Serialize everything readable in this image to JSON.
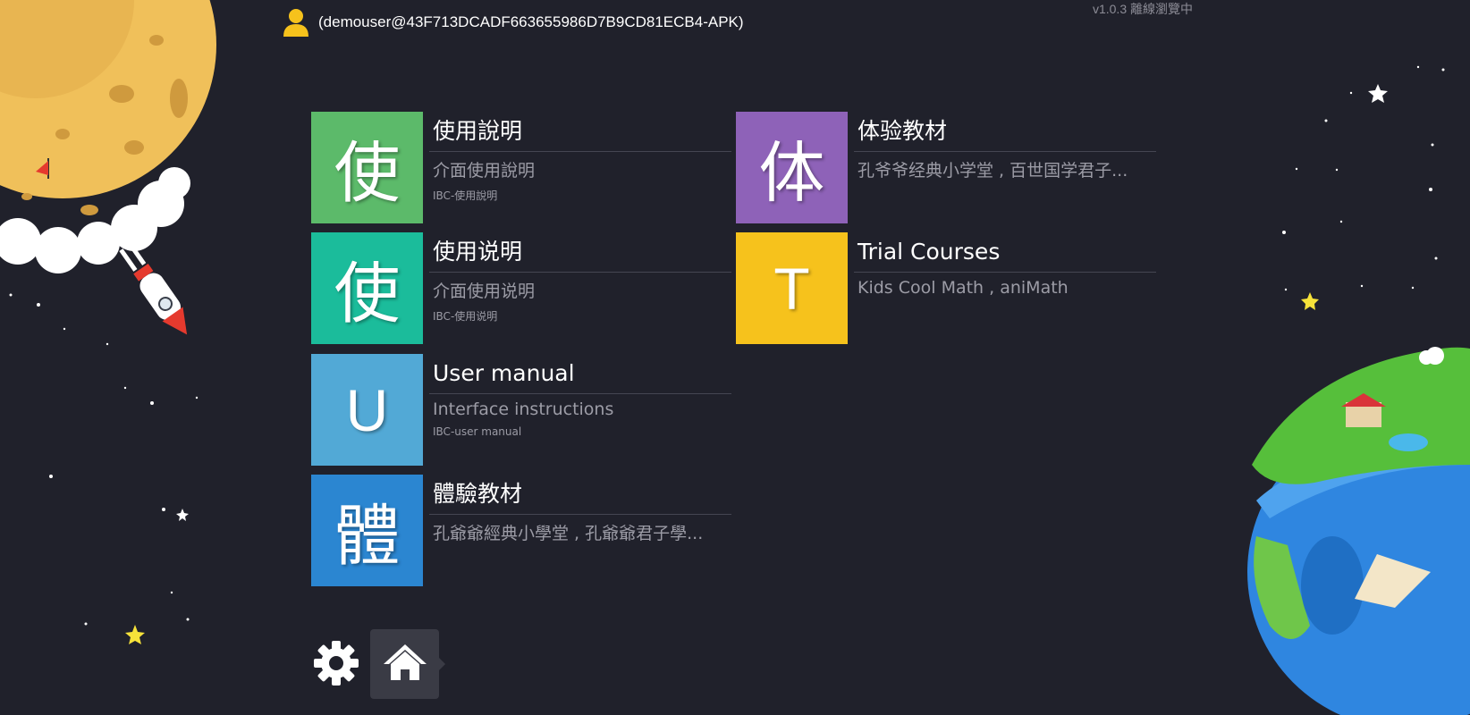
{
  "header": {
    "user_label": "(demouser@43F713DCADF663655986D7B9CD81ECB4-APK)",
    "version_label": "v1.0.3 離線瀏覽中"
  },
  "tiles": [
    {
      "glyph": "使",
      "color": "#5cba6a",
      "title": "使用說明",
      "description": "介面使用說明",
      "code": "IBC-使用說明"
    },
    {
      "glyph": "使",
      "color": "#1bbc9b",
      "title": "使用说明",
      "description": "介面使用说明",
      "code": "IBC-使用说明"
    },
    {
      "glyph": "U",
      "color": "#52a9d6",
      "title": "User manual",
      "description": "Interface instructions",
      "code": "IBC-user manual"
    },
    {
      "glyph": "體",
      "color": "#2b86d1",
      "title": "體驗教材",
      "description": "孔爺爺經典小學堂 , 孔爺爺君子學...",
      "code": ""
    },
    {
      "glyph": "体",
      "color": "#8e62b8",
      "title": "体验教材",
      "description": "孔爷爷经典小学堂 , 百世国学君子...",
      "code": ""
    },
    {
      "glyph": "T",
      "color": "#f6c21c",
      "title": "Trial Courses",
      "description": "Kids Cool Math , aniMath",
      "code": ""
    }
  ],
  "bottom_nav": {
    "settings_icon": "gear-icon",
    "home_icon": "home-icon"
  },
  "decorations": {
    "top_left": "cratered-moon",
    "left": "rocket",
    "right": "planet-island"
  }
}
